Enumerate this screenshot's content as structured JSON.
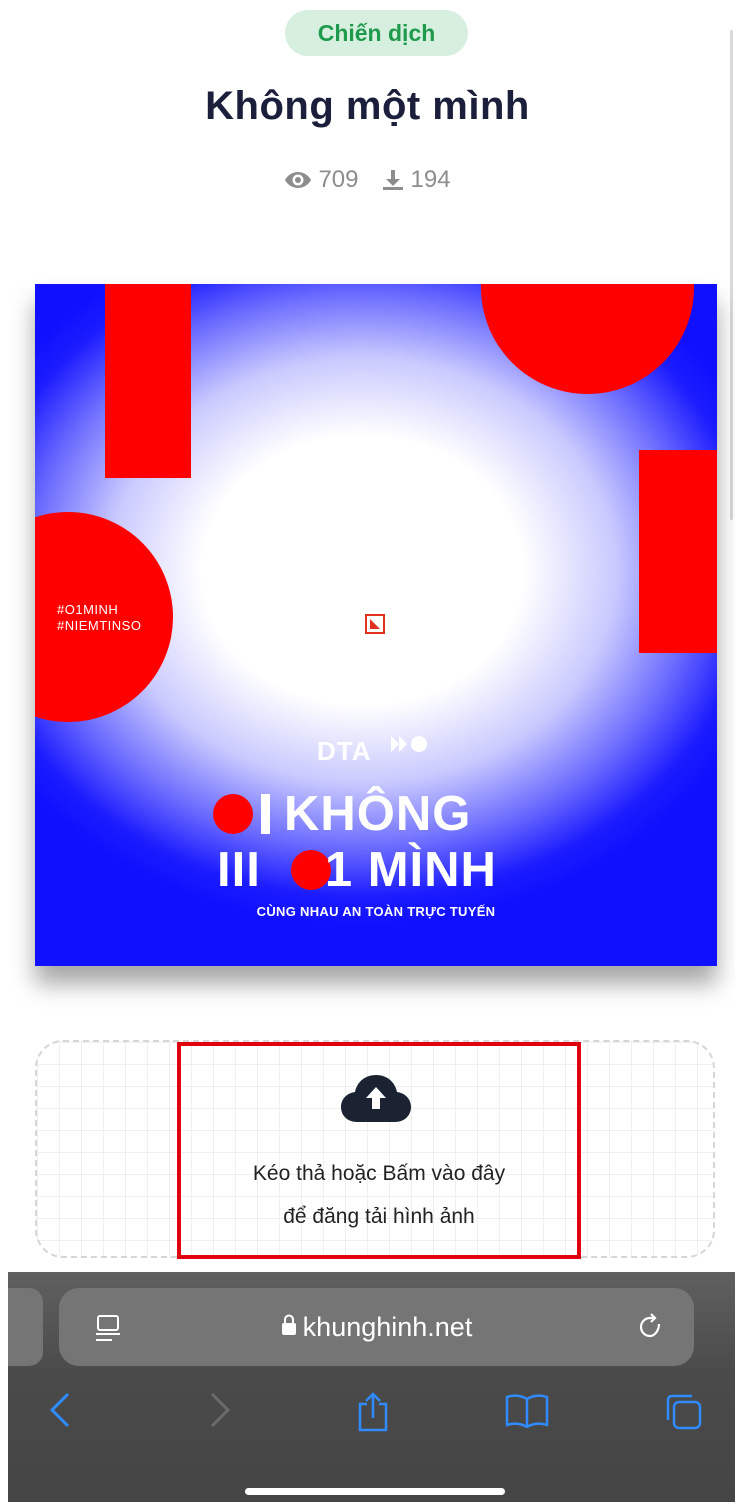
{
  "header": {
    "category_badge": "Chiến dịch",
    "title": "Không một mình",
    "views": "709",
    "downloads": "194"
  },
  "frame_image": {
    "hashtag_1": "#O1MINH",
    "hashtag_2": "#NIEMTINSO",
    "brand": "DTA",
    "line1": "KHÔNG",
    "line2_prefix": "III",
    "line2": "1 MÌNH",
    "tagline": "CÙNG NHAU AN TOÀN TRỰC TUYẾN",
    "colors": {
      "blue": "#1010ff",
      "red": "#ff0000"
    }
  },
  "upload": {
    "line1": "Kéo thả hoặc Bấm vào đây",
    "line2": "để đăng tải hình ảnh",
    "icon": "cloud-upload-icon",
    "highlight_color": "#e0000e"
  },
  "browser": {
    "url": "khunghinh.net",
    "icons": [
      "reader-icon",
      "lock-icon",
      "reload-icon",
      "back-icon",
      "forward-icon",
      "share-icon",
      "bookmarks-icon",
      "tabs-icon"
    ],
    "accent": "#2f8bff"
  }
}
